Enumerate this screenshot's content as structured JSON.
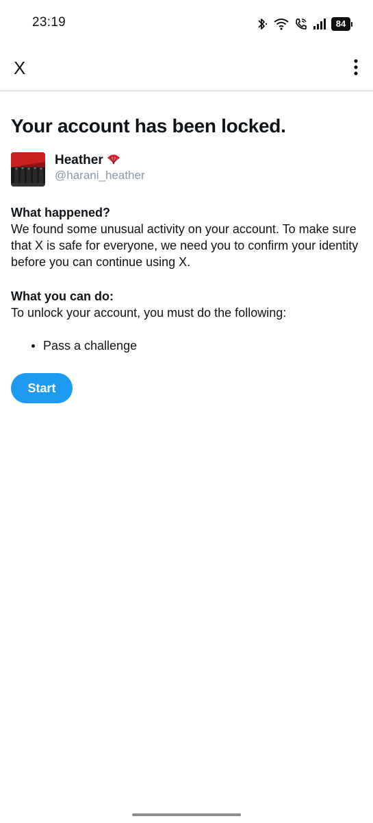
{
  "status_bar": {
    "time": "23:19",
    "battery": "84",
    "icons": [
      "bluetooth-icon",
      "wifi-icon",
      "wifi-calling-icon",
      "signal-icon",
      "battery-icon"
    ]
  },
  "app_bar": {
    "close_label": "X",
    "more_icon": "more-vertical-icon"
  },
  "page": {
    "title": "Your account has been locked."
  },
  "account": {
    "display_name": "Heather",
    "name_emoji": "fan-icon",
    "handle": "@harani_heather"
  },
  "what_happened": {
    "heading": "What happened?",
    "body": "We found some unusual activity on your account. To make sure that X is safe for everyone, we need you to confirm your identity before you can continue using X."
  },
  "what_you_can_do": {
    "heading": "What you can do:",
    "body": "To unlock your account, you must do the following:",
    "steps": [
      "Pass a challenge"
    ]
  },
  "actions": {
    "start_label": "Start"
  },
  "colors": {
    "accent": "#1d9bf0",
    "text": "#0f1419",
    "secondary_text": "#8b98a5",
    "divider": "#cfd9de"
  }
}
